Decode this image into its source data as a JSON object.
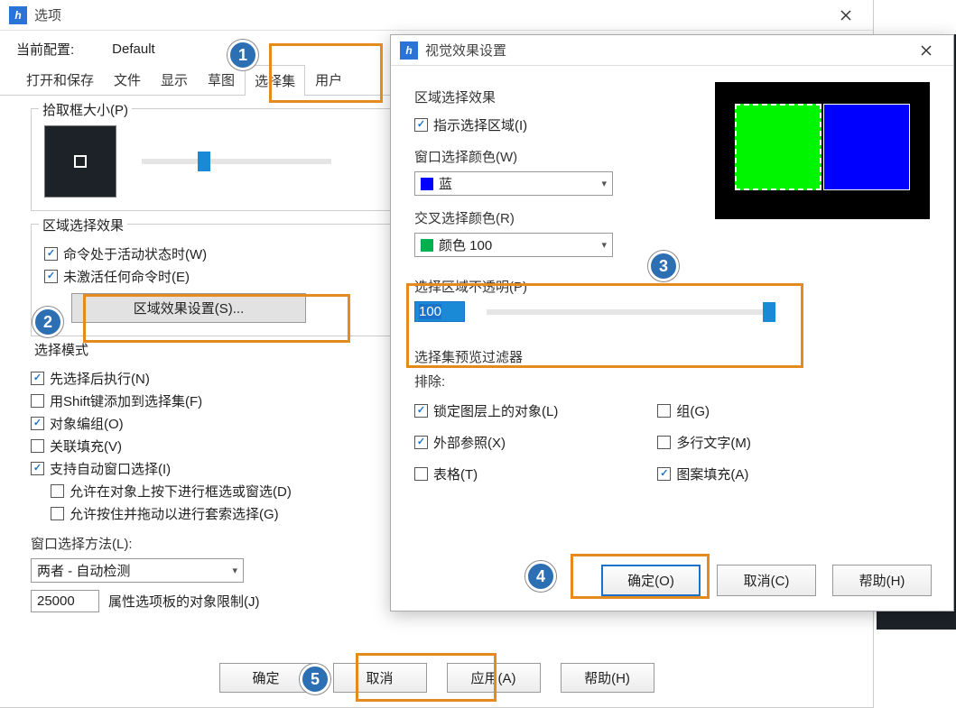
{
  "options": {
    "title": "选项",
    "config_label": "当前配置:",
    "config_value": "Default",
    "tabs": [
      "打开和保存",
      "文件",
      "显示",
      "草图",
      "选择集",
      "用户"
    ],
    "active_tab": 4,
    "pickbox_label": "拾取框大小(P)",
    "area_effect": {
      "group_label": "区域选择效果",
      "cmd_active": "命令处于活动状态时(W)",
      "no_cmd": "未激活任何命令时(E)",
      "area_settings_btn": "区域效果设置(S)..."
    },
    "select_mode": {
      "group_label": "选择模式",
      "pre_select": "先选择后执行(N)",
      "shift_add": "用Shift键添加到选择集(F)",
      "obj_group": "对象编组(O)",
      "assoc_fill": "关联填充(V)",
      "auto_window": "支持自动窗口选择(I)",
      "allow_press": "允许在对象上按下进行框选或窗选(D)",
      "allow_drag": "允许按住并拖动以进行套索选择(G)",
      "window_method_label": "窗口选择方法(L):",
      "window_method_value": "两者 - 自动检测",
      "limit_value": "25000",
      "limit_label": "属性选项板的对象限制(J)"
    },
    "btn_ok": "确定",
    "btn_cancel": "取消",
    "btn_apply": "应用(A)",
    "btn_help": "帮助(H)"
  },
  "visual": {
    "title": "视觉效果设置",
    "area_group": "区域选择效果",
    "indicate": "指示选择区域(I)",
    "window_color_label": "窗口选择颜色(W)",
    "window_color_value": "蓝",
    "cross_color_label": "交叉选择颜色(R)",
    "cross_color_value": "颜色 100",
    "opacity_label": "选择区域不透明(P)",
    "opacity_value": "100",
    "filter_group": "选择集预览过滤器",
    "exclude_label": "排除:",
    "locked": "锁定图层上的对象(L)",
    "group": "组(G)",
    "xref": "外部参照(X)",
    "mtext": "多行文字(M)",
    "table": "表格(T)",
    "hatch": "图案填充(A)",
    "btn_ok": "确定(O)",
    "btn_cancel": "取消(C)",
    "btn_help": "帮助(H)"
  }
}
